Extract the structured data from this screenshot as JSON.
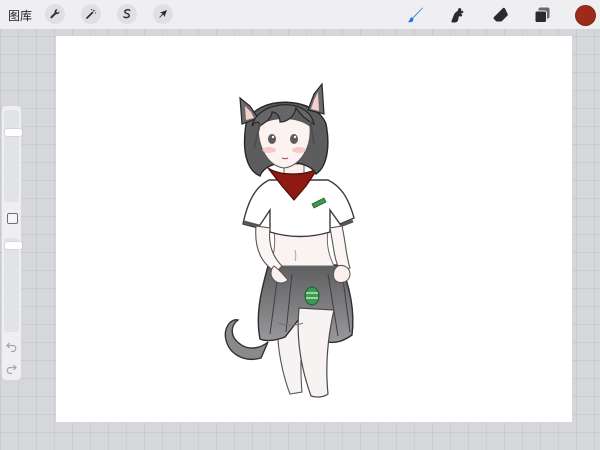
{
  "toolbar": {
    "gallery_label": "图库",
    "left_tools": [
      {
        "name": "wrench-icon",
        "action": "actions"
      },
      {
        "name": "magic-wand-icon",
        "action": "adjustments"
      },
      {
        "name": "selection-icon",
        "action": "selection"
      },
      {
        "name": "arrow-cursor-icon",
        "action": "transform"
      }
    ],
    "right_tools": [
      {
        "name": "brush-icon",
        "active": true,
        "color": "#1a73e8"
      },
      {
        "name": "smudge-icon",
        "active": false
      },
      {
        "name": "eraser-icon",
        "active": false
      },
      {
        "name": "layers-icon",
        "active": false
      }
    ],
    "current_color": "#9c2b1c"
  },
  "sidebar": {
    "size_slider_level": 0.78,
    "opacity_slider_level": 0.95
  },
  "colors": {
    "bandana": "#8e1a12",
    "badge": "#3b9a4e",
    "hair": "#6b6b6b",
    "skirt": "#6f6f6f"
  }
}
